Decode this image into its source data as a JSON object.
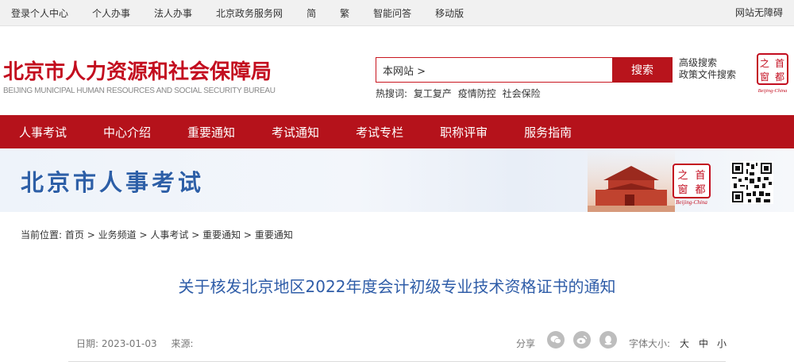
{
  "topbar": {
    "links": [
      "登录个人中心",
      "个人办事",
      "法人办事",
      "北京政务服务网",
      "简",
      "繁",
      "智能问答",
      "移动版"
    ],
    "accessibility": "网站无障碍"
  },
  "header": {
    "logo_cn": "北京市人力资源和社会保障局",
    "logo_en": "BEIJING MUNICIPAL HUMAN RESOURCES AND SOCIAL SECURITY BUREAU",
    "search_scope": "本网站 >",
    "search_button": "搜索",
    "advanced_search": "高级搜索",
    "policy_search": "政策文件搜索",
    "hot_label": "热搜词:",
    "hot_words": [
      "复工复产",
      "疫情防控",
      "社会保险"
    ],
    "seal_chars": [
      "之",
      "首",
      "窗",
      "都"
    ],
    "seal_caption": "Beijing-China"
  },
  "nav": {
    "items": [
      "人事考试",
      "中心介绍",
      "重要通知",
      "考试通知",
      "考试专栏",
      "职称评审",
      "服务指南"
    ]
  },
  "banner": {
    "title": "北京市人事考试",
    "seal_chars": [
      "之",
      "首",
      "窗",
      "都"
    ],
    "seal_caption": "Beijing-China"
  },
  "breadcrumb": {
    "label": "当前位置:",
    "items": [
      "首页",
      "业务频道",
      "人事考试",
      "重要通知",
      "重要通知"
    ],
    "separator": ">"
  },
  "article": {
    "title": "关于核发北京地区2022年度会计初级专业技术资格证书的通知",
    "date_label": "日期:",
    "date": "2023-01-03",
    "source_label": "来源:",
    "source": "",
    "share_label": "分享",
    "share_icons": [
      "wechat-icon",
      "weibo-icon",
      "qq-icon"
    ],
    "font_size_label": "字体大小:",
    "font_sizes": [
      "大",
      "中",
      "小"
    ]
  },
  "colors": {
    "brand_red": "#b5121b",
    "title_blue": "#2f5da8",
    "banner_blue": "#2d5fa7"
  }
}
